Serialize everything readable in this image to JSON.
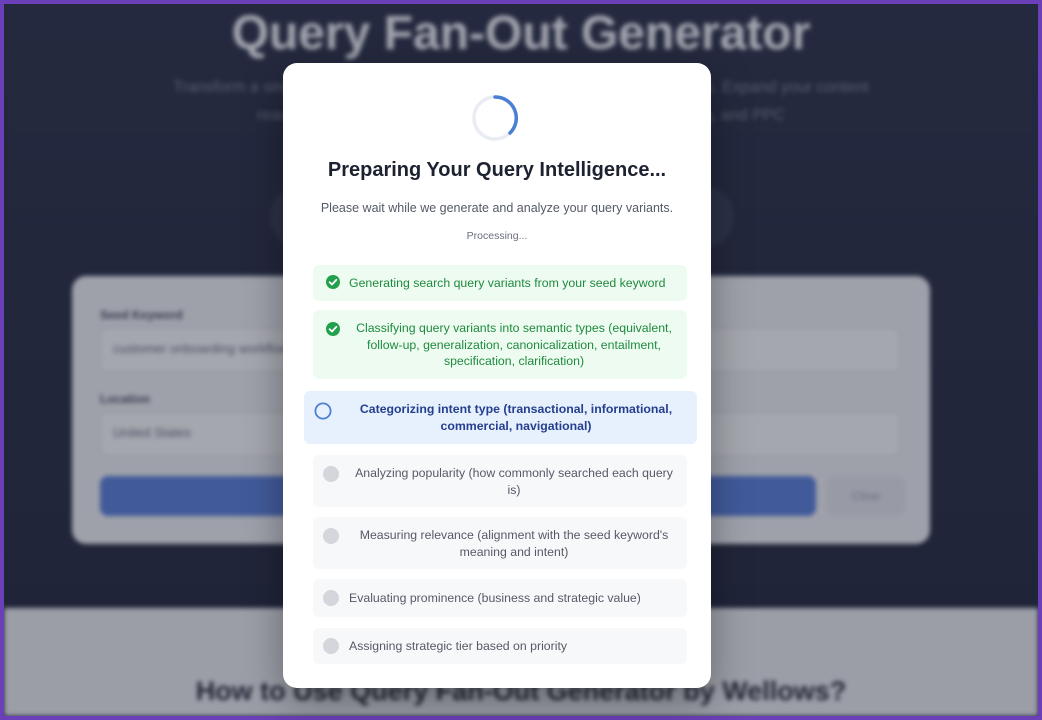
{
  "background": {
    "hero_title": "Query Fan-Out Generator",
    "hero_subtitle": "Transform a single seed keyword into a comprehensive set of query variants. Expand your content reach with smart keyword research, content strategy, retargeting, and PPC",
    "seed_keyword_label": "Seed Keyword",
    "seed_keyword_value": "customer onboarding workflow",
    "location_label": "Location",
    "location_value": "United States",
    "clear_label": "Clear",
    "section_title": "How to Use Query Fan-Out Generator by Wellows?"
  },
  "modal": {
    "title": "Preparing Your Query Intelligence...",
    "subtitle": "Please wait while we generate and analyze your query variants.",
    "status": "Processing...",
    "steps": [
      {
        "label": "Generating search query variants from your seed keyword",
        "state": "done"
      },
      {
        "label": "Classifying query variants into semantic types (equivalent, follow-up, generalization, canonicalization, entailment, specification, clarification)",
        "state": "done"
      },
      {
        "label": "Categorizing intent type (transactional, informational, commercial, navigational)",
        "state": "active"
      },
      {
        "label": "Analyzing popularity (how commonly searched each query is)",
        "state": "pending"
      },
      {
        "label": "Measuring relevance (alignment with the seed keyword's meaning and intent)",
        "state": "pending"
      },
      {
        "label": "Evaluating prominence (business and strategic value)",
        "state": "pending"
      },
      {
        "label": "Assigning strategic tier based on priority",
        "state": "pending"
      }
    ]
  },
  "icons": {
    "done": "check-circle-icon",
    "active": "circle-outline-icon",
    "pending": "circle-dot-icon"
  },
  "colors": {
    "accent": "#4a7fd4",
    "success": "#22a04b",
    "frame": "#6b3fb8"
  }
}
